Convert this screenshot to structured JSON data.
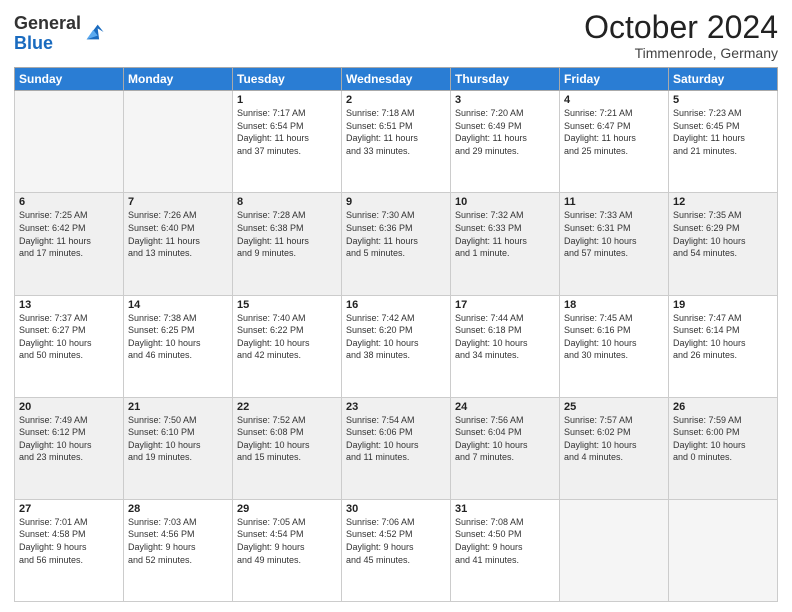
{
  "logo": {
    "general": "General",
    "blue": "Blue"
  },
  "header": {
    "month": "October 2024",
    "location": "Timmenrode, Germany"
  },
  "weekdays": [
    "Sunday",
    "Monday",
    "Tuesday",
    "Wednesday",
    "Thursday",
    "Friday",
    "Saturday"
  ],
  "weeks": [
    [
      {
        "day": "",
        "detail": ""
      },
      {
        "day": "",
        "detail": ""
      },
      {
        "day": "1",
        "detail": "Sunrise: 7:17 AM\nSunset: 6:54 PM\nDaylight: 11 hours\nand 37 minutes."
      },
      {
        "day": "2",
        "detail": "Sunrise: 7:18 AM\nSunset: 6:51 PM\nDaylight: 11 hours\nand 33 minutes."
      },
      {
        "day": "3",
        "detail": "Sunrise: 7:20 AM\nSunset: 6:49 PM\nDaylight: 11 hours\nand 29 minutes."
      },
      {
        "day": "4",
        "detail": "Sunrise: 7:21 AM\nSunset: 6:47 PM\nDaylight: 11 hours\nand 25 minutes."
      },
      {
        "day": "5",
        "detail": "Sunrise: 7:23 AM\nSunset: 6:45 PM\nDaylight: 11 hours\nand 21 minutes."
      }
    ],
    [
      {
        "day": "6",
        "detail": "Sunrise: 7:25 AM\nSunset: 6:42 PM\nDaylight: 11 hours\nand 17 minutes."
      },
      {
        "day": "7",
        "detail": "Sunrise: 7:26 AM\nSunset: 6:40 PM\nDaylight: 11 hours\nand 13 minutes."
      },
      {
        "day": "8",
        "detail": "Sunrise: 7:28 AM\nSunset: 6:38 PM\nDaylight: 11 hours\nand 9 minutes."
      },
      {
        "day": "9",
        "detail": "Sunrise: 7:30 AM\nSunset: 6:36 PM\nDaylight: 11 hours\nand 5 minutes."
      },
      {
        "day": "10",
        "detail": "Sunrise: 7:32 AM\nSunset: 6:33 PM\nDaylight: 11 hours\nand 1 minute."
      },
      {
        "day": "11",
        "detail": "Sunrise: 7:33 AM\nSunset: 6:31 PM\nDaylight: 10 hours\nand 57 minutes."
      },
      {
        "day": "12",
        "detail": "Sunrise: 7:35 AM\nSunset: 6:29 PM\nDaylight: 10 hours\nand 54 minutes."
      }
    ],
    [
      {
        "day": "13",
        "detail": "Sunrise: 7:37 AM\nSunset: 6:27 PM\nDaylight: 10 hours\nand 50 minutes."
      },
      {
        "day": "14",
        "detail": "Sunrise: 7:38 AM\nSunset: 6:25 PM\nDaylight: 10 hours\nand 46 minutes."
      },
      {
        "day": "15",
        "detail": "Sunrise: 7:40 AM\nSunset: 6:22 PM\nDaylight: 10 hours\nand 42 minutes."
      },
      {
        "day": "16",
        "detail": "Sunrise: 7:42 AM\nSunset: 6:20 PM\nDaylight: 10 hours\nand 38 minutes."
      },
      {
        "day": "17",
        "detail": "Sunrise: 7:44 AM\nSunset: 6:18 PM\nDaylight: 10 hours\nand 34 minutes."
      },
      {
        "day": "18",
        "detail": "Sunrise: 7:45 AM\nSunset: 6:16 PM\nDaylight: 10 hours\nand 30 minutes."
      },
      {
        "day": "19",
        "detail": "Sunrise: 7:47 AM\nSunset: 6:14 PM\nDaylight: 10 hours\nand 26 minutes."
      }
    ],
    [
      {
        "day": "20",
        "detail": "Sunrise: 7:49 AM\nSunset: 6:12 PM\nDaylight: 10 hours\nand 23 minutes."
      },
      {
        "day": "21",
        "detail": "Sunrise: 7:50 AM\nSunset: 6:10 PM\nDaylight: 10 hours\nand 19 minutes."
      },
      {
        "day": "22",
        "detail": "Sunrise: 7:52 AM\nSunset: 6:08 PM\nDaylight: 10 hours\nand 15 minutes."
      },
      {
        "day": "23",
        "detail": "Sunrise: 7:54 AM\nSunset: 6:06 PM\nDaylight: 10 hours\nand 11 minutes."
      },
      {
        "day": "24",
        "detail": "Sunrise: 7:56 AM\nSunset: 6:04 PM\nDaylight: 10 hours\nand 7 minutes."
      },
      {
        "day": "25",
        "detail": "Sunrise: 7:57 AM\nSunset: 6:02 PM\nDaylight: 10 hours\nand 4 minutes."
      },
      {
        "day": "26",
        "detail": "Sunrise: 7:59 AM\nSunset: 6:00 PM\nDaylight: 10 hours\nand 0 minutes."
      }
    ],
    [
      {
        "day": "27",
        "detail": "Sunrise: 7:01 AM\nSunset: 4:58 PM\nDaylight: 9 hours\nand 56 minutes."
      },
      {
        "day": "28",
        "detail": "Sunrise: 7:03 AM\nSunset: 4:56 PM\nDaylight: 9 hours\nand 52 minutes."
      },
      {
        "day": "29",
        "detail": "Sunrise: 7:05 AM\nSunset: 4:54 PM\nDaylight: 9 hours\nand 49 minutes."
      },
      {
        "day": "30",
        "detail": "Sunrise: 7:06 AM\nSunset: 4:52 PM\nDaylight: 9 hours\nand 45 minutes."
      },
      {
        "day": "31",
        "detail": "Sunrise: 7:08 AM\nSunset: 4:50 PM\nDaylight: 9 hours\nand 41 minutes."
      },
      {
        "day": "",
        "detail": ""
      },
      {
        "day": "",
        "detail": ""
      }
    ]
  ]
}
